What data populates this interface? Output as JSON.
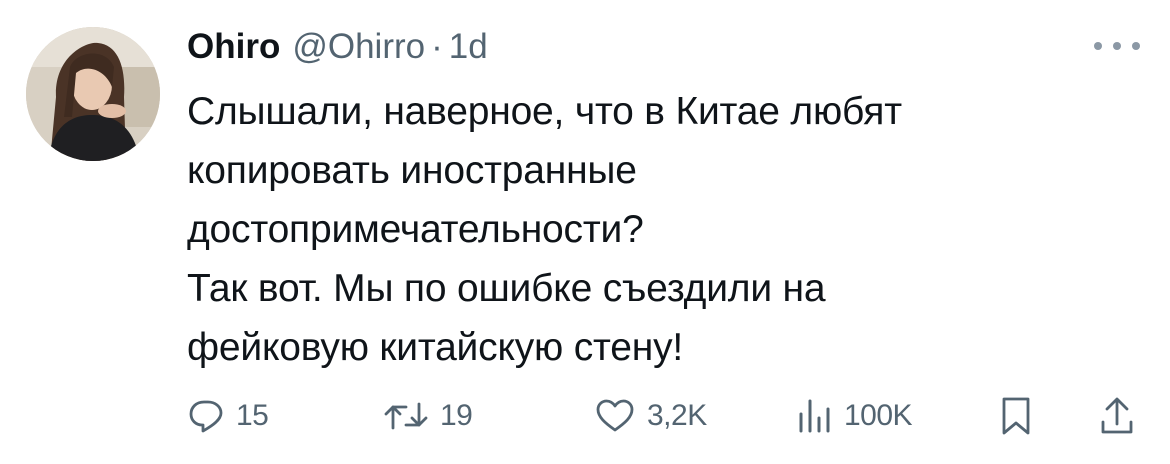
{
  "author": {
    "display_name": "Ohiro",
    "handle": "@Ohirro",
    "separator": "·",
    "time": "1d"
  },
  "tweet": {
    "lines": [
      "Слышали, наверное, что в Китае любят",
      "копировать иностранные",
      "достопримечательности?",
      "Так вот. Мы по ошибке съездили на",
      "фейковую китайскую стену!"
    ]
  },
  "actions": {
    "replies": "15",
    "retweets": "19",
    "likes": "3,2K",
    "views": "100K"
  },
  "icons": {
    "more": "more-dots-icon",
    "reply": "reply-bubble-icon",
    "retweet": "retweet-icon",
    "like": "heart-icon",
    "views": "views-bar-chart-icon",
    "bookmark": "bookmark-icon",
    "share": "share-upload-icon"
  },
  "colors": {
    "text": "#0f1419",
    "secondary": "#536471"
  }
}
